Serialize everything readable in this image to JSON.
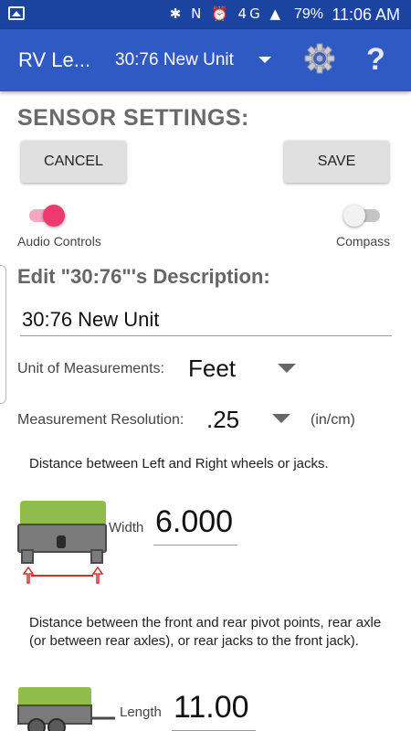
{
  "status_bar": {
    "icons": "✱ N ⏰ 4G ▲",
    "battery": "79%",
    "time": "11:06 AM"
  },
  "app_bar": {
    "title": "RV Le...",
    "selected_unit": "30:76 New Unit"
  },
  "sensor_settings": {
    "title": "SENSOR SETTINGS:",
    "cancel_label": "CANCEL",
    "save_label": "SAVE",
    "audio_controls_label": "Audio Controls",
    "audio_controls_on": true,
    "compass_label": "Compass",
    "compass_on": false
  },
  "description": {
    "heading": "Edit \"30:76\"'s Description:",
    "value": "30:76 New Unit"
  },
  "measurement": {
    "unit_label": "Unit of Measurements:",
    "unit_value": "Feet",
    "resolution_label": "Measurement Resolution:",
    "resolution_value": ".25",
    "resolution_unit": "(in/cm)"
  },
  "width": {
    "description": "Distance between Left and Right wheels or jacks.",
    "label": "Width",
    "value": "6.000"
  },
  "length": {
    "description": "Distance between the front and rear pivot points, rear axle (or between rear axles), or rear jacks to the front jack).",
    "label": "Length",
    "value": "11.00"
  },
  "colors": {
    "app_bar": "#2f59c3",
    "status_bar": "#1a44a0",
    "accent_pink": "#f0396e",
    "rv_green": "#8fbd4a",
    "arrow_red": "#d32f2f"
  }
}
